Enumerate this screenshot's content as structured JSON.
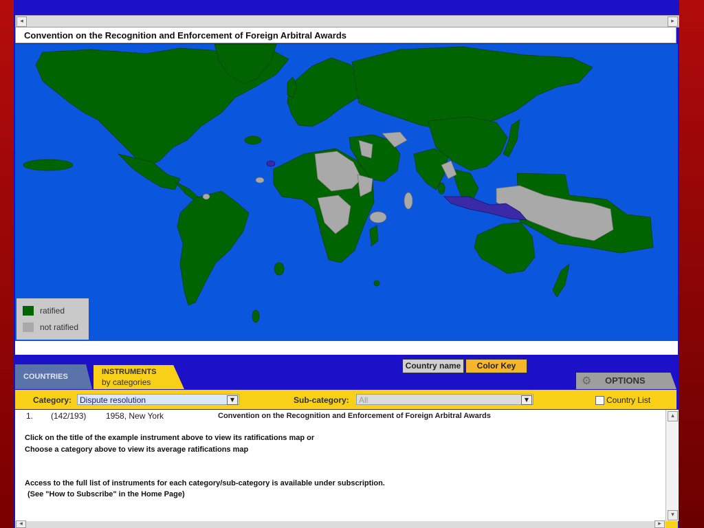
{
  "map": {
    "title": "Convention on the Recognition and Enforcement of Foreign Arbitral Awards",
    "legend": [
      {
        "label": "ratified",
        "color": "#006400"
      },
      {
        "label": "not ratified",
        "color": "#a9a9a9"
      }
    ],
    "colors": {
      "ocean": "#0a56dc",
      "ratified": "#006400",
      "not_ratified": "#a9a9a9",
      "highlight": "#3a2aa8"
    }
  },
  "key_bar": {
    "country_name": "Country name",
    "color_key": "Color Key"
  },
  "tabs": {
    "countries": "COUNTRIES",
    "instruments_line1": "INSTRUMENTS",
    "instruments_line2": "by categories",
    "options": "OPTIONS"
  },
  "filters": {
    "category_label": "Category:",
    "category_value": "Dispute resolution",
    "subcategory_label": "Sub-category:",
    "subcategory_value": "All",
    "country_list_label": "Country List"
  },
  "instruments": [
    {
      "num": "1.",
      "count": "(142/193)",
      "year_place": "1958, New York",
      "title": "Convention on the Recognition and Enforcement of Foreign Arbitral Awards"
    }
  ],
  "messages": {
    "line1": "Click on the title of the example instrument above to view its ratifications map or",
    "line2": "Choose a category above to view its average ratifications map",
    "line3": "Access to the full list of instruments for each category/sub-category is available under subscription.",
    "line4": "(See \"How to Subscribe\" in the Home Page)"
  },
  "icons": {
    "scroll_left": "◂",
    "scroll_right": "▸",
    "scroll_up": "▴",
    "scroll_down": "▾",
    "dropdown": "▼",
    "gear": "⚙"
  }
}
